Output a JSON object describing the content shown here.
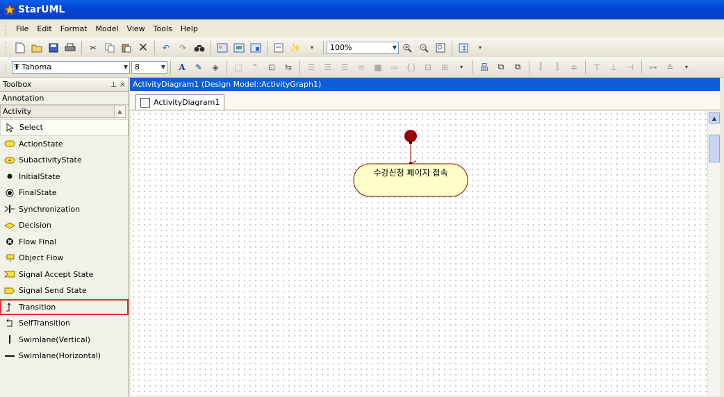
{
  "window": {
    "title": "StarUML"
  },
  "menu": [
    "File",
    "Edit",
    "Format",
    "Model",
    "View",
    "Tools",
    "Help"
  ],
  "toolbar": {
    "zoom": "100%",
    "font_name": "Tahoma",
    "font_size": "8"
  },
  "toolbox": {
    "title": "Toolbox",
    "pin": "♁ ×",
    "sections": [
      "Annotation",
      "Activity"
    ],
    "tools": [
      {
        "label": "Select",
        "icon": "cursor-icon"
      },
      {
        "label": "ActionState",
        "icon": "action-state-icon"
      },
      {
        "label": "SubactivityState",
        "icon": "subactivity-state-icon"
      },
      {
        "label": "InitialState",
        "icon": "initial-state-icon"
      },
      {
        "label": "FinalState",
        "icon": "final-state-icon"
      },
      {
        "label": "Synchronization",
        "icon": "synchronization-icon"
      },
      {
        "label": "Decision",
        "icon": "decision-icon"
      },
      {
        "label": "Flow Final",
        "icon": "flow-final-icon"
      },
      {
        "label": "Object Flow",
        "icon": "object-flow-icon"
      },
      {
        "label": "Signal Accept State",
        "icon": "signal-accept-icon"
      },
      {
        "label": "Signal Send State",
        "icon": "signal-send-icon"
      },
      {
        "label": "Transition",
        "icon": "transition-icon"
      },
      {
        "label": "SelfTransition",
        "icon": "self-transition-icon"
      },
      {
        "label": "Swimlane(Vertical)",
        "icon": "swimlane-vertical-icon"
      },
      {
        "label": "Swimlane(Horizontal)",
        "icon": "swimlane-horizontal-icon"
      }
    ]
  },
  "document": {
    "path": "ActivityDiagram1 (Design Model::ActivityGraph1)",
    "tab": "ActivityDiagram1"
  },
  "diagram": {
    "activity_label": "수강신청 페이지 접속"
  },
  "colors": {
    "titlebar": "#0a5fe6",
    "docbar": "#0b5ed7",
    "initial_state": "#990000",
    "activity_fill": "#fffec8",
    "activity_border": "#8b0000",
    "highlight": "#e03030"
  }
}
